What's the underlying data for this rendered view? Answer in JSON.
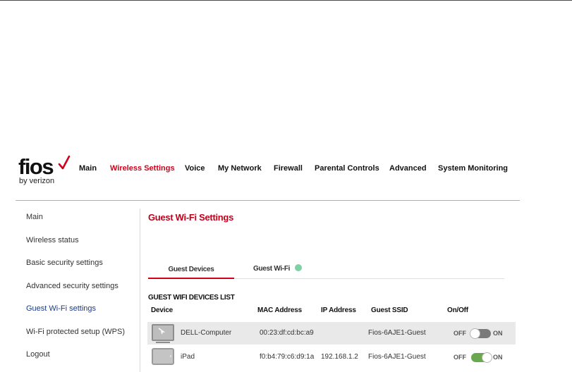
{
  "brand": {
    "logo_word": "fios",
    "logo_sub": "by verizon",
    "check_color": "#d0021b"
  },
  "nav": {
    "items": [
      {
        "label": "Main"
      },
      {
        "label": "Wireless Settings"
      },
      {
        "label": "Voice"
      },
      {
        "label": "My Network"
      },
      {
        "label": "Firewall"
      },
      {
        "label": "Parental Controls"
      },
      {
        "label": "Advanced"
      },
      {
        "label": "System Monitoring"
      }
    ],
    "active": "Wireless Settings"
  },
  "sidebar": {
    "items": [
      {
        "label": "Main"
      },
      {
        "label": "Wireless status"
      },
      {
        "label": "Basic security settings"
      },
      {
        "label": "Advanced security settings"
      },
      {
        "label": "Guest Wi-Fi settings"
      },
      {
        "label": "Wi-Fi protected setup (WPS)"
      },
      {
        "label": "Logout"
      }
    ],
    "active": "Guest Wi-Fi settings"
  },
  "page": {
    "title": "Guest Wi-Fi Settings"
  },
  "tabs": {
    "items": [
      {
        "label": "Guest Devices"
      },
      {
        "label": "Guest Wi-Fi"
      }
    ],
    "active": "Guest Devices",
    "guest_wifi_status_color": "#7fd1a3"
  },
  "devices": {
    "title": "GUEST WIFI DEVICES LIST",
    "columns": [
      "Device",
      "MAC Address",
      "IP Address",
      "Guest SSID",
      "On/Off"
    ],
    "rows": [
      {
        "icon": "computer-icon",
        "device": "DELL-Computer",
        "mac": "00:23:df:cd:bc:a9",
        "ip": "",
        "ssid": "Fios-6AJE1-Guest",
        "off_label": "OFF",
        "on_label": "ON",
        "enabled": false
      },
      {
        "icon": "tablet-icon",
        "device": "iPad",
        "mac": "f0:b4:79:c6:d9:1a",
        "ip": "192.168.1.2",
        "ssid": "Fios-6AJE1-Guest",
        "off_label": "OFF",
        "on_label": "ON",
        "enabled": true
      }
    ]
  },
  "colors": {
    "accent_red": "#d0021b",
    "toggle_on": "#6aa84f",
    "toggle_off": "#7a7a7a",
    "active_sidebar": "#1a3a8a"
  }
}
